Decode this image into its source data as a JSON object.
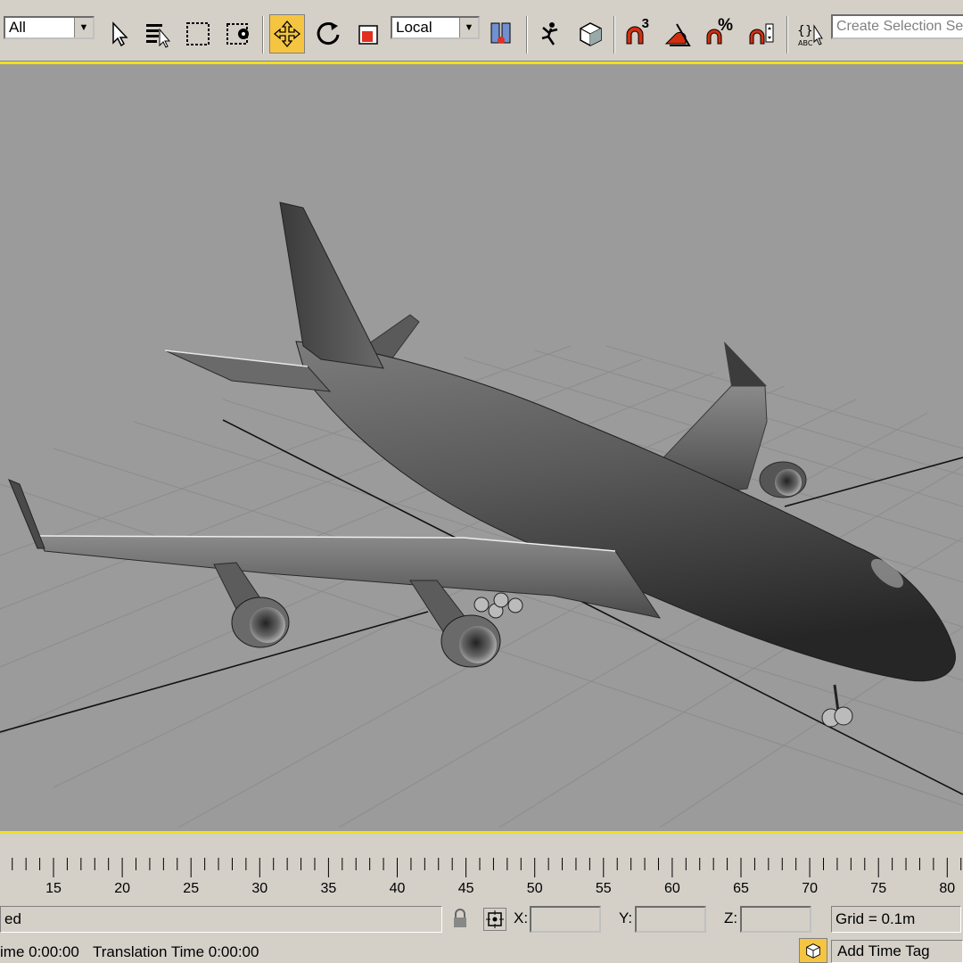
{
  "toolbar": {
    "filter": {
      "value": "All"
    },
    "reference_coord": {
      "value": "Local"
    },
    "selection_set": {
      "placeholder": "Create Selection Set"
    },
    "snap_angle_label": "3",
    "percent_label": "%"
  },
  "viewport": {
    "background": "#9b9b9b",
    "border_color": "#f0e020"
  },
  "timeline": {
    "ticks": [
      "15",
      "20",
      "25",
      "30",
      "35",
      "40",
      "45",
      "50",
      "55",
      "60",
      "65",
      "70",
      "75",
      "80"
    ]
  },
  "status": {
    "prompt": "ed",
    "x_label": "X:",
    "y_label": "Y:",
    "z_label": "Z:",
    "x_value": "",
    "y_value": "",
    "z_value": "",
    "grid": "Grid = 0.1m",
    "render_time": "ime  0:00:00",
    "translation_time": "Translation Time  0:00:00",
    "time_tag": "Add Time Tag"
  },
  "colors": {
    "accent": "#f5c542",
    "ui_face": "#d4d0c8",
    "snap_red": "#d03010"
  }
}
